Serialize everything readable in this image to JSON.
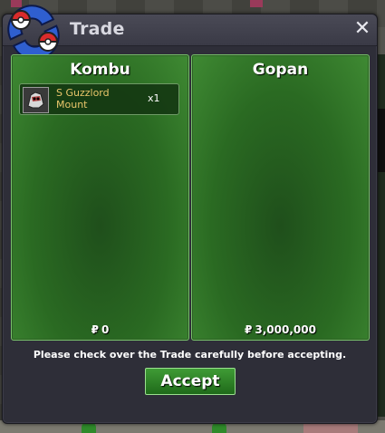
{
  "window": {
    "title": "Trade",
    "close_label": "✕"
  },
  "left_panel": {
    "player_name": "Kombu",
    "items": [
      {
        "name_line1": "S Guzzlord",
        "name_line2": "Mount",
        "quantity": "x1",
        "icon": "mount-icon"
      }
    ],
    "currency_symbol": "₽",
    "money": "0"
  },
  "right_panel": {
    "player_name": "Gopan",
    "items": [],
    "currency_symbol": "₽",
    "money": "3,000,000"
  },
  "notice": "Please check over the Trade carefully before accepting.",
  "accept_label": "Accept",
  "colors": {
    "panel_green": "#2a6a22",
    "accent_gold": "#e9c66a",
    "window_bg": "#2e2e38"
  }
}
